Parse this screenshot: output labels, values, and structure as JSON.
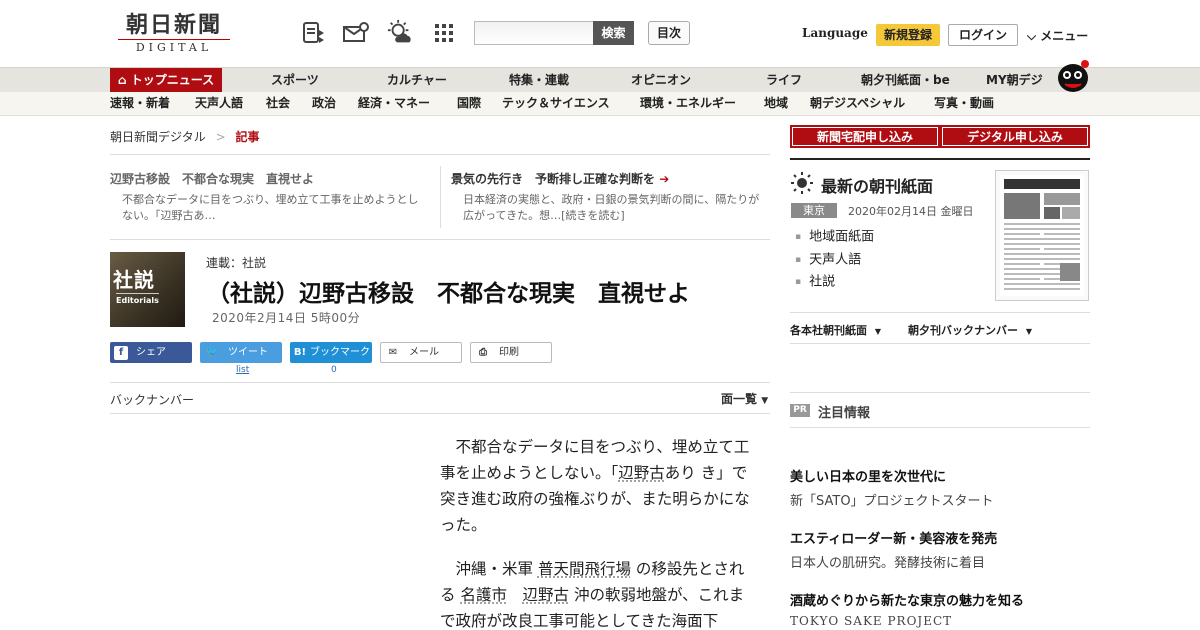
{
  "header": {
    "logo_kanji": "朝日新聞",
    "logo_sub": "DIGITAL",
    "search_placeholder": "",
    "search_button": "検索",
    "index_button": "目次",
    "language": "Language",
    "register": "新規登録",
    "login": "ログイン",
    "menu": "メニュー",
    "icons": [
      "news-digest-icon",
      "mail-icon",
      "weather-icon",
      "grid-icon"
    ]
  },
  "nav_primary": [
    "トップニュース",
    "スポーツ",
    "カルチャー",
    "特集・連載",
    "オピニオン",
    "ライフ",
    "朝夕刊紙面・be",
    "MY朝デジ"
  ],
  "nav_secondary": [
    "速報・新着",
    "天声人語",
    "社会",
    "政治",
    "経済・マネー",
    "国際",
    "テック＆サイエンス",
    "環境・エネルギー",
    "地域",
    "朝デジスペシャル",
    "写真・動画"
  ],
  "breadcrumb": {
    "home": "朝日新聞デジタル",
    "separator": ">",
    "current": "記事"
  },
  "related": [
    {
      "title": "辺野古移設　不都合な現実　直視せよ",
      "desc": "不都合なデータに目をつぶり、埋め立て工事を止めようとしない。「辺野古あ…"
    },
    {
      "title": "景気の先行き　予断排し正確な判断を",
      "desc": "日本経済の実態と、政府・日銀の景気判断の間に、隔たりが広がってきた。想…[続きを読む]"
    }
  ],
  "article": {
    "thumb_big": "社説",
    "thumb_small": "Editorials",
    "series": "連載：社説",
    "title": "（社説）辺野古移設　不都合な現実　直視せよ",
    "date": "2020年2月14日 5時00分",
    "share": {
      "facebook": "シェア",
      "twitter": "ツイート",
      "hatena": "ブックマーク",
      "mail": "メール",
      "print": "印刷",
      "twitter_count": "list",
      "hatena_count": "0"
    },
    "backnumber": "バックナンバー",
    "pagelist": "面一覧",
    "body_p1_a": "不都合なデータに目をつぶり、埋め立て工事を止めようとしない。「",
    "body_p1_link": "辺野古",
    "body_p1_b": "あり き」で突き進む政府の強権ぶりが、また明らかになった。",
    "body_p2_a": "沖縄・米軍",
    "body_p2_link1": "普天間飛行場",
    "body_p2_b": "の移設先とされる",
    "body_p2_link2": "名護市",
    "body_p2_link3": "辺野古",
    "body_p2_c": "沖の軟弱地盤が、これまで政府が改良工事可能としてきた海面下"
  },
  "sidebar": {
    "sub_home": "新聞宅配申し込み",
    "sub_digital": "デジタル申し込み",
    "paper_title": "最新の朝刊紙面",
    "edition": "東京",
    "paper_date": "2020年02月14日 金曜日",
    "paper_links": [
      "地域面紙面",
      "天声人語",
      "社説"
    ],
    "dd_left": "各本社朝刊紙面",
    "dd_right": "朝夕刊バックナンバー",
    "pr_badge": "PR",
    "pr_title": "注目情報",
    "ads": [
      {
        "title": "美しい日本の里を次世代に",
        "sub": "新「SATO」プロジェクトスタート"
      },
      {
        "title": "エスティローダー新・美容液を発売",
        "sub": "日本人の肌研究。発酵技術に着目"
      },
      {
        "title": "酒蔵めぐりから新たな東京の魅力を知る",
        "sub": "TOKYO SAKE PROJECT"
      }
    ]
  },
  "colors": {
    "brand_red": "#b00d12",
    "register_yellow": "#f5c83a",
    "nav_bg": "#e6e4de"
  }
}
